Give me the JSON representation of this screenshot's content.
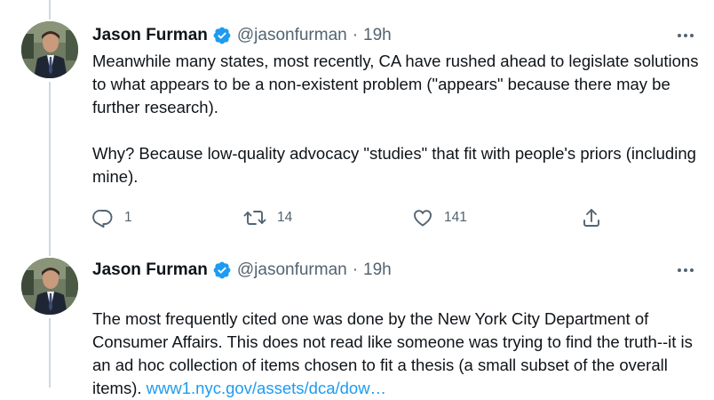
{
  "tweets": [
    {
      "author_name": "Jason Furman",
      "author_handle": "@jasonfurman",
      "separator": "·",
      "time": "19h",
      "text": "Meanwhile many states, most recently, CA have rushed ahead to legislate solutions to what appears to be a non-existent problem (\"appears\" because there may be further research).\n\nWhy? Because low-quality advocacy \"studies\" that fit with people's priors (including mine).",
      "actions": {
        "reply_count": "1",
        "retweet_count": "14",
        "like_count": "141"
      },
      "icons": [
        "verified-badge-icon",
        "more-icon",
        "reply-icon",
        "retweet-icon",
        "like-icon",
        "share-icon"
      ]
    },
    {
      "author_name": "Jason Furman",
      "author_handle": "@jasonfurman",
      "separator": "·",
      "time": "19h",
      "text": "The most frequently cited one was done by the New York City Department of Consumer Affairs. This does not read like someone was trying to find the truth--it is an ad hoc collection of items chosen to fit a thesis (a small subset of the overall items). ",
      "link_text": "www1.nyc.gov/assets/dca/dow…",
      "icons": [
        "verified-badge-icon",
        "more-icon"
      ]
    }
  ],
  "colors": {
    "text": "#0f1419",
    "secondary": "#536471",
    "link": "#1d9bf0",
    "verified": "#1d9bf0",
    "thread_line": "#cfd9de"
  }
}
